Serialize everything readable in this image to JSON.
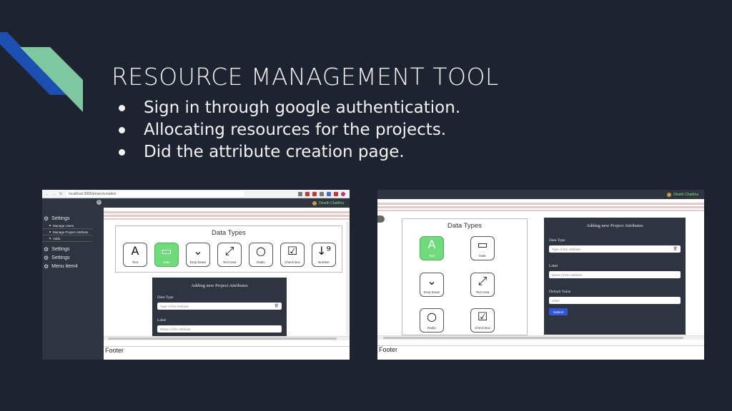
{
  "slide": {
    "title": "RESOURCE MANAGEMENT TOOL",
    "bullets": [
      "Sign in through google authentication.",
      "Allocating resources for the projects.",
      "Did the attribute creation page."
    ],
    "colors": {
      "background": "#1e2330",
      "deco_blue": "#1d4fb2",
      "deco_green": "#7fc7a0"
    }
  },
  "shot1": {
    "url": "localhost:3000/projectcreation",
    "user_name": "Dineth Chathha",
    "sidebar": {
      "items": [
        {
          "label": "Settings",
          "sub": [
            "Manage Users",
            "Manage Project Attribute",
            "Add1"
          ]
        },
        {
          "label": "Settings"
        },
        {
          "label": "Settings"
        },
        {
          "label": "Menu item4"
        }
      ]
    },
    "data_types": {
      "title": "Data Types",
      "tiles": [
        {
          "icon": "text-icon",
          "glyph": "A",
          "label": "Text",
          "selected": false
        },
        {
          "icon": "date-icon",
          "glyph": "▭",
          "label": "Date",
          "selected": true
        },
        {
          "icon": "dropdown-icon",
          "glyph": "⌄",
          "label": "Drop Down",
          "selected": false
        },
        {
          "icon": "textarea-icon",
          "glyph": "⤢",
          "label": "Text Area",
          "selected": false
        },
        {
          "icon": "radio-icon",
          "glyph": "○",
          "label": "Radio",
          "selected": false
        },
        {
          "icon": "checkbox-icon",
          "glyph": "☑",
          "label": "Check Box",
          "selected": false
        },
        {
          "icon": "number-icon",
          "glyph": "↓⁹",
          "label": "Number",
          "selected": false
        }
      ]
    },
    "form": {
      "heading": "Adding new Project Attributes",
      "data_type_label": "Data Type",
      "data_type_placeholder": "Type of the Attribute",
      "label_label": "Label",
      "label_placeholder": "Name of the Attribute"
    },
    "footer": "Footer"
  },
  "shot2": {
    "user_name": "Dineth Chathha",
    "data_types": {
      "title": "Data Types",
      "tiles": [
        {
          "icon": "text-icon",
          "glyph": "A",
          "label": "Text",
          "selected": true
        },
        {
          "icon": "date-icon",
          "glyph": "▭",
          "label": "Date",
          "selected": false
        },
        {
          "icon": "dropdown-icon",
          "glyph": "⌄",
          "label": "Drop Down",
          "selected": false
        },
        {
          "icon": "textarea-icon",
          "glyph": "⤢",
          "label": "Text Area",
          "selected": false
        },
        {
          "icon": "radio-icon",
          "glyph": "○",
          "label": "Radio",
          "selected": false
        },
        {
          "icon": "checkbox-icon",
          "glyph": "☑",
          "label": "Check Box",
          "selected": false
        }
      ]
    },
    "form": {
      "heading": "Adding new Project Attributes",
      "data_type_label": "Data Type",
      "data_type_placeholder": "Type of the Attribute",
      "label_label": "Label",
      "label_placeholder": "Name of the Attribute",
      "default_label": "Default Value",
      "default_placeholder": "value",
      "submit": "Submit"
    },
    "footer": "Footer"
  }
}
